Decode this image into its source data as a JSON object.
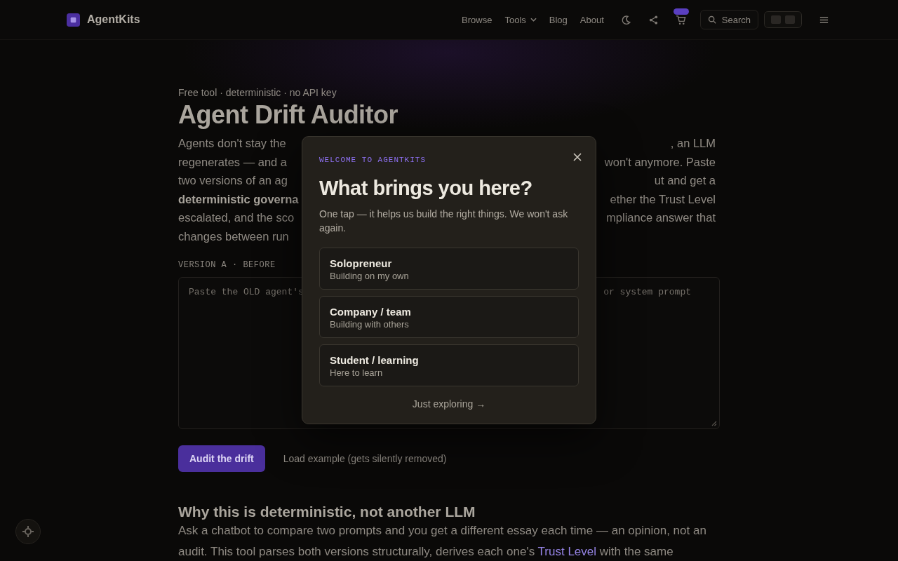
{
  "header": {
    "brand": "AgentKits",
    "nav": [
      {
        "label": "Browse",
        "has_menu": false
      },
      {
        "label": "Tools",
        "has_menu": true
      },
      {
        "label": "Blog",
        "has_menu": false
      },
      {
        "label": "About",
        "has_menu": false
      }
    ],
    "search": {
      "label": "Search"
    }
  },
  "hero": {
    "eyebrow": "Free tool · deterministic · no API key",
    "title": "Agent Drift Auditor",
    "intro_lines": [
      {
        "left": "Agents don't stay the",
        "right": ", an LLM",
        "left_bold": false
      },
      {
        "left": "regenerates — and a",
        "right": "won't anymore. Paste",
        "left_bold": false
      },
      {
        "left": "two versions of an ag",
        "right": "ut and get a",
        "left_bold": false
      },
      {
        "left": "deterministic governa",
        "right": "ether the Trust Level",
        "left_bold": true
      },
      {
        "left": "escalated, and the sco",
        "right": "mpliance answer that",
        "left_bold": false
      },
      {
        "left": "changes between run",
        "left_bold": false
      }
    ]
  },
  "form": {
    "field_label": "VERSION A · BEFORE",
    "placeholder_parts": [
      "Paste the OLD agent's",
      "or system prompt"
    ],
    "primary_button": "Audit the drift",
    "example_link": "Load example (gets silently removed)"
  },
  "explainer": {
    "heading": "Why this is deterministic, not another LLM",
    "text_before": "Ask a chatbot to compare two prompts and you get a different essay each time — an opinion, not an audit. This tool parses both versions structurally, derives each one's ",
    "link": "Trust Level",
    "text_after": " with the same"
  },
  "modal": {
    "eyebrow": "WELCOME TO AGENTKITS",
    "title": "What brings you here?",
    "subtitle": "One tap — it helps us build the right things. We won't ask again.",
    "options": [
      {
        "title": "Solopreneur",
        "description": "Building on my own",
        "selected": false
      },
      {
        "title": "Company / team",
        "description": "Building with others",
        "selected": false
      },
      {
        "title": "Student / learning",
        "description": "Here to learn",
        "selected": false
      }
    ],
    "skip_link": "Just exploring →"
  }
}
